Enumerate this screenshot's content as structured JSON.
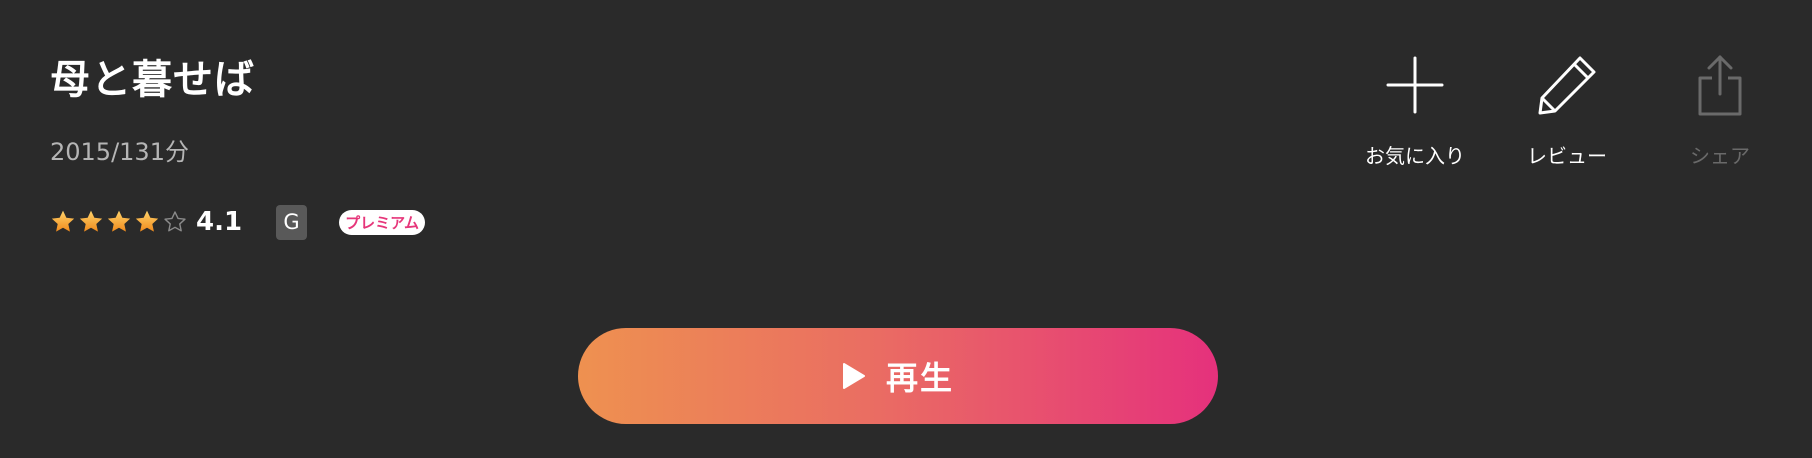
{
  "movie": {
    "title": "母と暮せば",
    "meta": "2015/131分",
    "rating": {
      "score": "4.1",
      "filled_stars": 4,
      "max_stars": 5
    },
    "age_badge": "G",
    "premium_badge": "プレミアム"
  },
  "actions": {
    "favorite": {
      "label": "お気に入り",
      "icon": "plus-icon"
    },
    "review": {
      "label": "レビュー",
      "icon": "pencil-icon"
    },
    "share": {
      "label": "シェア",
      "icon": "share-icon"
    }
  },
  "play": {
    "label": "再生",
    "icon": "play-icon"
  },
  "colors": {
    "background": "#2a2a2a",
    "star_filled": "#f6a92c",
    "gradient_start": "#ee9150",
    "gradient_end": "#e5317c",
    "premium_text": "#e6367a",
    "disabled_text": "#6a6a6a"
  }
}
